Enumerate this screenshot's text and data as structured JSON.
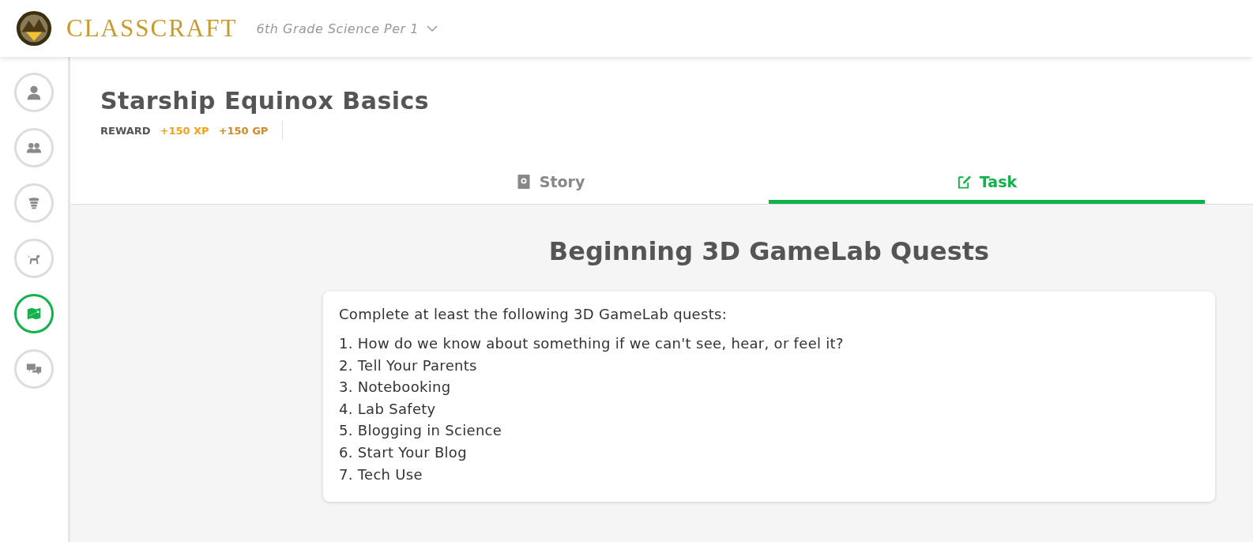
{
  "header": {
    "logo_text": "CLASSCRAFT",
    "class_selector": "6th Grade Science Per 1"
  },
  "sidebar": {
    "items": [
      {
        "kind": "person",
        "selected": false
      },
      {
        "kind": "people",
        "selected": false
      },
      {
        "kind": "armor",
        "selected": false
      },
      {
        "kind": "pet",
        "selected": false
      },
      {
        "kind": "map",
        "selected": true
      },
      {
        "kind": "chat",
        "selected": false
      }
    ]
  },
  "quest": {
    "title": "Starship Equinox Basics",
    "reward_label": "REWARD",
    "xp": "+150 XP",
    "gp": "+150 GP"
  },
  "tabs": [
    {
      "kind": "story",
      "label": "Story",
      "selected": false
    },
    {
      "kind": "task",
      "label": "Task",
      "selected": true
    }
  ],
  "task": {
    "heading": "Beginning 3D GameLab Quests",
    "intro": "Complete at least the following 3D GameLab quests:",
    "items": [
      {
        "number": "1.",
        "text": "How do we know about something if we can't see, hear, or feel it?"
      },
      {
        "number": "2.",
        "text": "Tell Your Parents"
      },
      {
        "number": "3.",
        "text": "Notebooking"
      },
      {
        "number": "4.",
        "text": "Lab Safety"
      },
      {
        "number": "5.",
        "text": "Blogging in Science"
      },
      {
        "number": "6.",
        "text": "Start Your Blog"
      },
      {
        "number": "7.",
        "text": "Tech Use"
      }
    ]
  }
}
